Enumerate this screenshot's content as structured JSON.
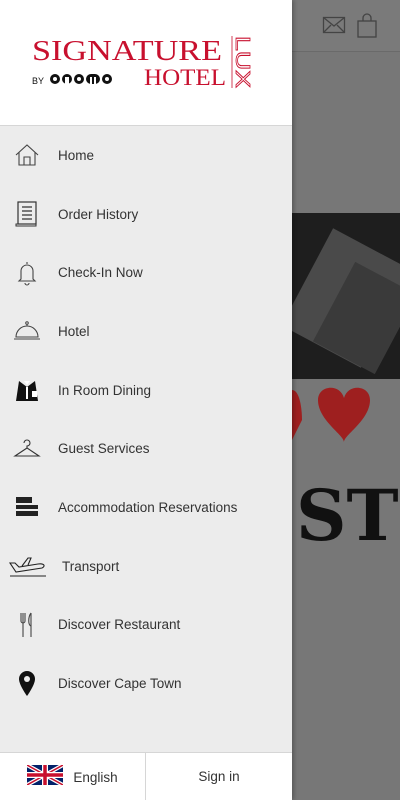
{
  "brand": {
    "name_main": "SIGNATURE",
    "name_side": "LUX",
    "by": "BY",
    "partner": "ONOMO",
    "hotel": "HOTEL",
    "brand_color": "#c8102e"
  },
  "menu": [
    {
      "label": "Home",
      "icon": "home-icon"
    },
    {
      "label": "Order History",
      "icon": "receipt-icon"
    },
    {
      "label": "Check-In Now",
      "icon": "bell-icon"
    },
    {
      "label": "Hotel",
      "icon": "cloche-icon"
    },
    {
      "label": "In Room Dining",
      "icon": "waiter-icon"
    },
    {
      "label": "Guest Services",
      "icon": "hanger-icon"
    },
    {
      "label": "Accommodation Reservations",
      "icon": "bed-icon"
    },
    {
      "label": "Transport",
      "icon": "plane-icon"
    },
    {
      "label": "Discover Restaurant",
      "icon": "cutlery-icon"
    },
    {
      "label": "Discover Cape Town",
      "icon": "location-pin-icon"
    }
  ],
  "footer": {
    "language_label": "English",
    "language_icon": "uk-flag-icon",
    "signin_label": "Sign in"
  },
  "background": {
    "icons": [
      "mail-icon",
      "shopping-bag-icon"
    ]
  }
}
